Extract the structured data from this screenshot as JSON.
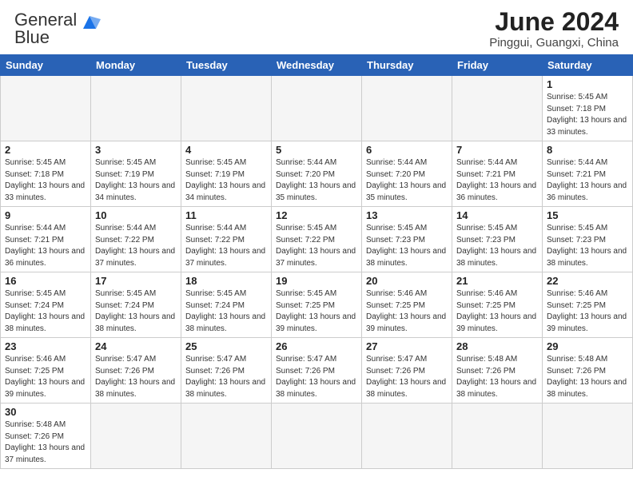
{
  "header": {
    "logo_general": "General",
    "logo_blue": "Blue",
    "title": "June 2024",
    "subtitle": "Pinggui, Guangxi, China"
  },
  "weekdays": [
    "Sunday",
    "Monday",
    "Tuesday",
    "Wednesday",
    "Thursday",
    "Friday",
    "Saturday"
  ],
  "weeks": [
    [
      {
        "day": "",
        "empty": true
      },
      {
        "day": "",
        "empty": true
      },
      {
        "day": "",
        "empty": true
      },
      {
        "day": "",
        "empty": true
      },
      {
        "day": "",
        "empty": true
      },
      {
        "day": "",
        "empty": true
      },
      {
        "day": "1",
        "info": "Sunrise: 5:45 AM\nSunset: 7:18 PM\nDaylight: 13 hours and 33 minutes."
      }
    ],
    [
      {
        "day": "2",
        "info": "Sunrise: 5:45 AM\nSunset: 7:18 PM\nDaylight: 13 hours and 33 minutes."
      },
      {
        "day": "3",
        "info": "Sunrise: 5:45 AM\nSunset: 7:19 PM\nDaylight: 13 hours and 34 minutes."
      },
      {
        "day": "4",
        "info": "Sunrise: 5:45 AM\nSunset: 7:19 PM\nDaylight: 13 hours and 34 minutes."
      },
      {
        "day": "5",
        "info": "Sunrise: 5:44 AM\nSunset: 7:20 PM\nDaylight: 13 hours and 35 minutes."
      },
      {
        "day": "6",
        "info": "Sunrise: 5:44 AM\nSunset: 7:20 PM\nDaylight: 13 hours and 35 minutes."
      },
      {
        "day": "7",
        "info": "Sunrise: 5:44 AM\nSunset: 7:21 PM\nDaylight: 13 hours and 36 minutes."
      },
      {
        "day": "8",
        "info": "Sunrise: 5:44 AM\nSunset: 7:21 PM\nDaylight: 13 hours and 36 minutes."
      }
    ],
    [
      {
        "day": "9",
        "info": "Sunrise: 5:44 AM\nSunset: 7:21 PM\nDaylight: 13 hours and 36 minutes."
      },
      {
        "day": "10",
        "info": "Sunrise: 5:44 AM\nSunset: 7:22 PM\nDaylight: 13 hours and 37 minutes."
      },
      {
        "day": "11",
        "info": "Sunrise: 5:44 AM\nSunset: 7:22 PM\nDaylight: 13 hours and 37 minutes."
      },
      {
        "day": "12",
        "info": "Sunrise: 5:45 AM\nSunset: 7:22 PM\nDaylight: 13 hours and 37 minutes."
      },
      {
        "day": "13",
        "info": "Sunrise: 5:45 AM\nSunset: 7:23 PM\nDaylight: 13 hours and 38 minutes."
      },
      {
        "day": "14",
        "info": "Sunrise: 5:45 AM\nSunset: 7:23 PM\nDaylight: 13 hours and 38 minutes."
      },
      {
        "day": "15",
        "info": "Sunrise: 5:45 AM\nSunset: 7:23 PM\nDaylight: 13 hours and 38 minutes."
      }
    ],
    [
      {
        "day": "16",
        "info": "Sunrise: 5:45 AM\nSunset: 7:24 PM\nDaylight: 13 hours and 38 minutes."
      },
      {
        "day": "17",
        "info": "Sunrise: 5:45 AM\nSunset: 7:24 PM\nDaylight: 13 hours and 38 minutes."
      },
      {
        "day": "18",
        "info": "Sunrise: 5:45 AM\nSunset: 7:24 PM\nDaylight: 13 hours and 38 minutes."
      },
      {
        "day": "19",
        "info": "Sunrise: 5:45 AM\nSunset: 7:25 PM\nDaylight: 13 hours and 39 minutes."
      },
      {
        "day": "20",
        "info": "Sunrise: 5:46 AM\nSunset: 7:25 PM\nDaylight: 13 hours and 39 minutes."
      },
      {
        "day": "21",
        "info": "Sunrise: 5:46 AM\nSunset: 7:25 PM\nDaylight: 13 hours and 39 minutes."
      },
      {
        "day": "22",
        "info": "Sunrise: 5:46 AM\nSunset: 7:25 PM\nDaylight: 13 hours and 39 minutes."
      }
    ],
    [
      {
        "day": "23",
        "info": "Sunrise: 5:46 AM\nSunset: 7:25 PM\nDaylight: 13 hours and 39 minutes."
      },
      {
        "day": "24",
        "info": "Sunrise: 5:47 AM\nSunset: 7:26 PM\nDaylight: 13 hours and 38 minutes."
      },
      {
        "day": "25",
        "info": "Sunrise: 5:47 AM\nSunset: 7:26 PM\nDaylight: 13 hours and 38 minutes."
      },
      {
        "day": "26",
        "info": "Sunrise: 5:47 AM\nSunset: 7:26 PM\nDaylight: 13 hours and 38 minutes."
      },
      {
        "day": "27",
        "info": "Sunrise: 5:47 AM\nSunset: 7:26 PM\nDaylight: 13 hours and 38 minutes."
      },
      {
        "day": "28",
        "info": "Sunrise: 5:48 AM\nSunset: 7:26 PM\nDaylight: 13 hours and 38 minutes."
      },
      {
        "day": "29",
        "info": "Sunrise: 5:48 AM\nSunset: 7:26 PM\nDaylight: 13 hours and 38 minutes."
      }
    ],
    [
      {
        "day": "30",
        "info": "Sunrise: 5:48 AM\nSunset: 7:26 PM\nDaylight: 13 hours and 37 minutes."
      },
      {
        "day": "",
        "empty": true
      },
      {
        "day": "",
        "empty": true
      },
      {
        "day": "",
        "empty": true
      },
      {
        "day": "",
        "empty": true
      },
      {
        "day": "",
        "empty": true
      },
      {
        "day": "",
        "empty": true
      }
    ]
  ]
}
